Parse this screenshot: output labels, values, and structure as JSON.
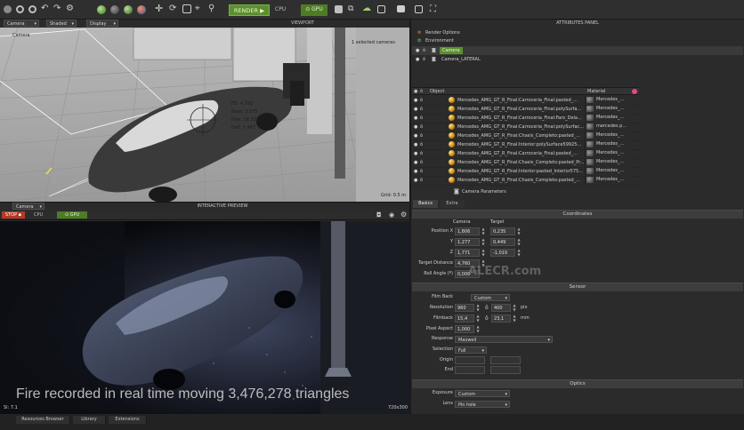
{
  "viewport_toolbar": {
    "camera_select": "Camera",
    "shaded_select": "Shaded",
    "display_select": "Display",
    "render_label": "RENDER",
    "cpu_label": "CPU",
    "gpu_label": "GPU"
  },
  "viewport": {
    "title": "VIEWPORT",
    "camera_name": "Camera",
    "selected_info": "1 selected cameras",
    "readouts": [
      "FD: 4.760",
      "Near: 3.575",
      "Fars: 18.333",
      "DoF: 7.467"
    ],
    "grid_info": "Grid: 0.5 m"
  },
  "preview_toolbar": {
    "camera_select": "Camera",
    "title": "INTERACTIVE PREVIEW",
    "stop_label": "STOP",
    "cpu_label": "CPU",
    "gpu_label": "GPU"
  },
  "preview": {
    "caption": "Fire recorded in real time moving 3,476,278 triangles",
    "sl_label": "Sl: 7.1",
    "resolution": "720x300"
  },
  "bottom_tabs": [
    "Resources Browser",
    "Library",
    "Extensions"
  ],
  "attributes_panel": {
    "title": "ATTRIBUTES PANEL",
    "tree": {
      "render_options": "Render Options",
      "environment": "Environment",
      "camera": "Camera",
      "camera_lateral": "Camera_LATERAL"
    },
    "object_header": "Object",
    "material_header": "Material",
    "objects": [
      {
        "name": "Mercedes_AMG_GT_R_Final:Carroceria_Final:pasted_...",
        "material": "Mercedes_..."
      },
      {
        "name": "Mercedes_AMG_GT_R_Final:Carroceria_Final:polySurfa...",
        "material": "Mercedes_..."
      },
      {
        "name": "Mercedes_AMG_GT_R_Final:Carroceria_Final:Faro_Dela...",
        "material": "Mercedes_..."
      },
      {
        "name": "Mercedes_AMG_GT_R_Final:Carroceria_Final:polySurfac...",
        "material": "mercedes p..."
      },
      {
        "name": "Mercedes_AMG_GT_R_Final:Chasis_Completo:pasted_...",
        "material": "Mercedes_..."
      },
      {
        "name": "Mercedes_AMG_GT_R_Final:Interior:polySurface59925...",
        "material": "Mercedes_..."
      },
      {
        "name": "Mercedes_AMG_GT_R_Final:Carroceria_Final:pasted_...",
        "material": "Mercedes_..."
      },
      {
        "name": "Mercedes_AMG_GT_R_Final:Chasis_Completo:pasted_Pr...",
        "material": "Mercedes_..."
      },
      {
        "name": "Mercedes_AMG_GT_R_Final:Interior:pasted_Interior575...",
        "material": "Mercedes_..."
      },
      {
        "name": "Mercedes_AMG_GT_R_Final:Chasis_Completo:pasted_...",
        "material": "Mercedes_..."
      }
    ],
    "camera_params_title": "Camera Parameters",
    "tabs": [
      "Basics",
      "Extra"
    ],
    "coordinates": {
      "section": "Coordinates",
      "col_camera": "Camera",
      "col_target": "Target",
      "position_x_label": "Position X",
      "y_label": "Y",
      "z_label": "Z",
      "pos_x": "1,806",
      "tgt_x": "0,235",
      "pos_y": "1,277",
      "tgt_y": "0,449",
      "pos_z": "1,771",
      "tgt_z": "-1,019",
      "target_distance_label": "Target Distance",
      "target_distance": "4,760",
      "roll_angle_label": "Roll Angle (º)",
      "roll_angle": "0,000"
    },
    "sensor": {
      "section": "Sensor",
      "film_back_label": "Film Back",
      "film_back": "Custom",
      "resolution_label": "Resolution",
      "res_w": "960",
      "res_h": "400",
      "res_unit": "pix",
      "filmback_label": "Filmback",
      "fb_w": "15,4",
      "fb_h": "23,1",
      "fb_unit": "mm",
      "pixel_aspect_label": "Pixel Aspect",
      "pixel_aspect": "1,000",
      "response_label": "Response",
      "response": "Maxwell",
      "selection_label": "Selection",
      "selection": "Full",
      "origin_label": "Origin",
      "end_label": "End"
    },
    "optics": {
      "section": "Optics",
      "exposure_label": "Exposure",
      "exposure": "Custom",
      "lens_label": "Lens",
      "lens": "Pin hole"
    }
  },
  "watermark": "ALECR.com",
  "colors": {
    "accent_green": "#5b8f2e",
    "stop_red": "#b33a2a",
    "panel_bg": "#2b2b2b"
  }
}
